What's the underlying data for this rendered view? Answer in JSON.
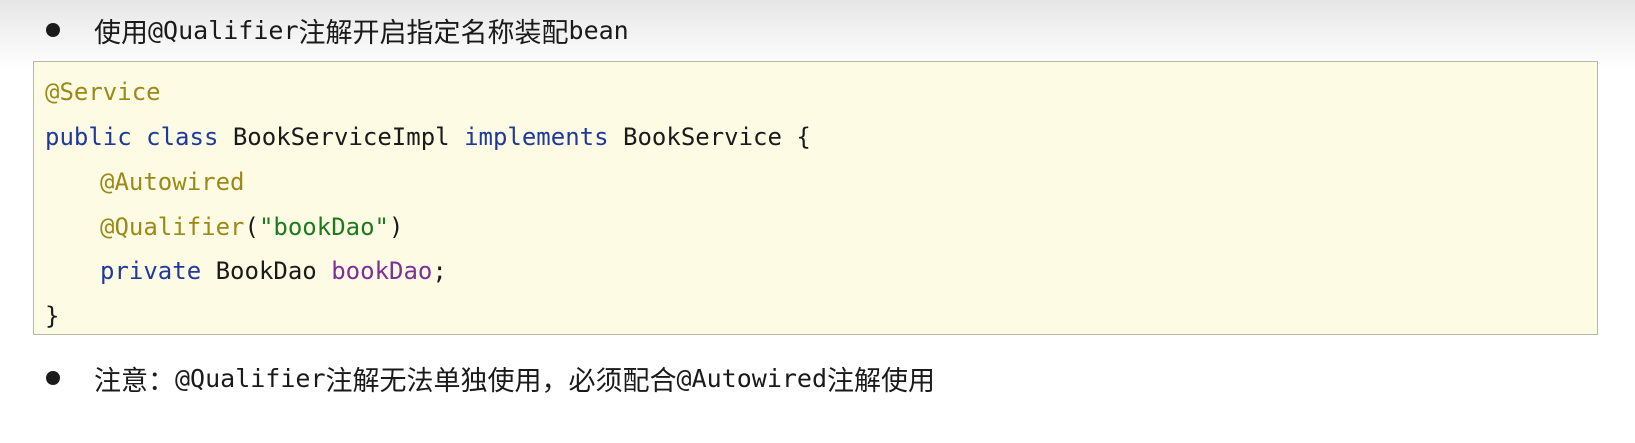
{
  "bullets": {
    "top": {
      "prefix": "使用",
      "code": "@Qualifier",
      "middle": "注解开启指定名称装配",
      "suffix": "bean"
    },
    "bottom": {
      "prefix": "注意：",
      "code1": "@Qualifier",
      "middle": "注解无法单独使用，必须配合",
      "code2": "@Autowired",
      "suffix": "注解使用"
    }
  },
  "code": {
    "line1": {
      "annotation": "@Service"
    },
    "line2": {
      "kw1": "public",
      "kw2": "class",
      "name": "BookServiceImpl",
      "kw3": "implements",
      "iface": "BookService",
      "brace": "{"
    },
    "line3": {
      "annotation": "@Autowired"
    },
    "line4": {
      "annotation": "@Qualifier",
      "open": "(",
      "string": "\"bookDao\"",
      "close": ")"
    },
    "line5": {
      "kw": "private",
      "type": "BookDao",
      "field": "bookDao",
      "semi": ";"
    },
    "line6": {
      "brace": "}"
    }
  },
  "colors": {
    "annotation": "#9b8a18",
    "keyword": "#1f3a9a",
    "string": "#1f7a1f",
    "field": "#7d2f9a",
    "code_background": "#fdfbe3"
  }
}
